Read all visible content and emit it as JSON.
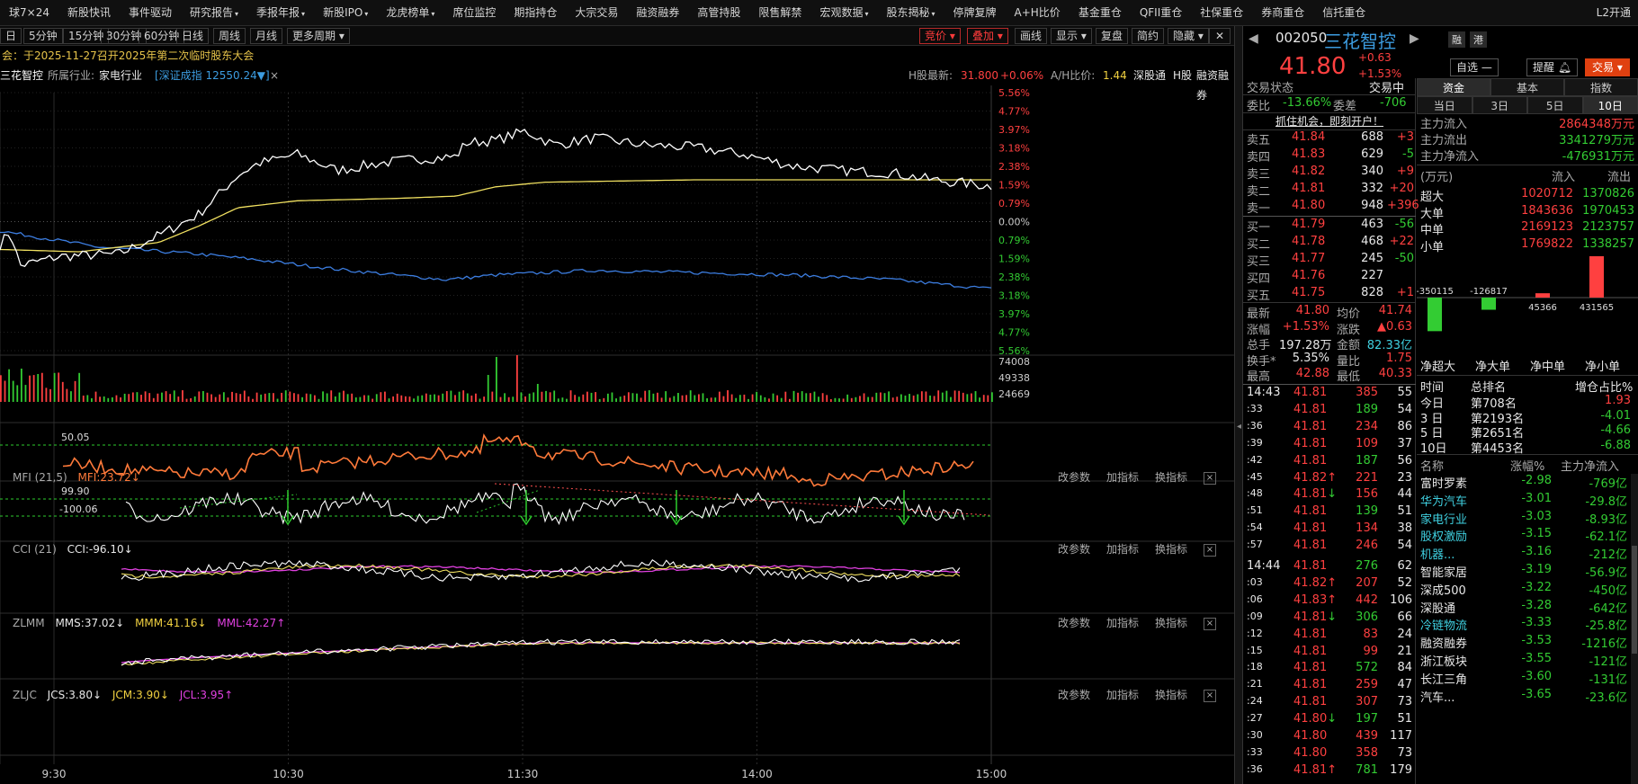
{
  "nav": [
    "球7×24",
    "新股快讯",
    "事件驱动",
    "研究报告",
    "季报年报",
    "新股IPO",
    "龙虎榜单",
    "席位监控",
    "期指持仓",
    "大宗交易",
    "融资融券",
    "高管持股",
    "限售解禁",
    "宏观数据",
    "股东揭秘",
    "停牌复牌",
    "A+H比价",
    "基金重仓",
    "QFII重仓",
    "社保重仓",
    "券商重仓",
    "信托重仓"
  ],
  "nav_right": "L2开通",
  "periods": [
    "日",
    "5分钟",
    "15分钟",
    "30分钟",
    "60分钟",
    "日线",
    "周线",
    "月线",
    "更多周期"
  ],
  "toolbar": {
    "auction": "竞价",
    "overlay": "叠加",
    "draw": "画线",
    "display": "显示",
    "replay": "复盘",
    "simple": "简约",
    "hide": "隐藏"
  },
  "notice": "会：于2025-11-27召开2025年第二次临时股东大会",
  "info": {
    "name": "三花智控",
    "industry_label": "所属行业:",
    "industry": "家电行业",
    "index": "[深证成指 12550.24▼]",
    "h_label": "H股最新:",
    "h_price": "31.800",
    "h_pct": "+0.06%",
    "ah_label": "A/H比价:",
    "ah": "1.44",
    "sz": "深股通",
    "h": "H股",
    "rz": "融资融券"
  },
  "price_axis": {
    "right_up": [
      "5.56%",
      "4.77%",
      "3.97%",
      "3.18%",
      "2.38%",
      "1.59%",
      "0.79%",
      "0.00%",
      "0.79%",
      "1.59%",
      "2.38%",
      "3.18%",
      "3.97%",
      "4.77%",
      "5.56%"
    ]
  },
  "vol_axis": [
    "74008",
    "49338",
    "24669"
  ],
  "time_axis": [
    "9:30",
    "10:30",
    "11:30",
    "14:00",
    "15:00"
  ],
  "ind": {
    "mfi": {
      "name": "MFI (21,5)",
      "val": "MFI:23.72↓",
      "l1": "50.05"
    },
    "cci": {
      "name": "CCI (21)",
      "val": "CCI:-96.10↓",
      "l1": "99.90",
      "l2": "-100.06"
    },
    "zlmm": {
      "name": "ZLMM",
      "a": "MMS:37.02↓",
      "b": "MMM:41.16↓",
      "c": "MML:42.27↑"
    },
    "zljc": {
      "name": "ZLJC",
      "a": "JCS:3.80↓",
      "b": "JCM:3.90↓",
      "c": "JCL:3.95↑"
    },
    "tools": {
      "p": "改参数",
      "a": "加指标",
      "c": "换指标",
      "x": "×"
    }
  },
  "quote": {
    "code": "002050",
    "name": "三花智控",
    "price": "41.80",
    "chg": "+0.63",
    "pct": "+1.53%",
    "rong": "融",
    "gang": "港",
    "zixuan": "自选",
    "remind": "提醒",
    "trade": "交易"
  },
  "status": {
    "label": "交易状态",
    "val": "交易中",
    "wb_l": "委比",
    "wb": "-13.66%",
    "wc_l": "委差",
    "wc": "-706",
    "ad": "抓住机会，即刻开户！"
  },
  "sells": [
    [
      "卖五",
      "41.84",
      "688",
      "+3"
    ],
    [
      "卖四",
      "41.83",
      "629",
      "-5"
    ],
    [
      "卖三",
      "41.82",
      "340",
      "+9"
    ],
    [
      "卖二",
      "41.81",
      "332",
      "+20"
    ],
    [
      "卖一",
      "41.80",
      "948",
      "+396"
    ]
  ],
  "buys": [
    [
      "买一",
      "41.79",
      "463",
      "-56"
    ],
    [
      "买二",
      "41.78",
      "468",
      "+22"
    ],
    [
      "买三",
      "41.77",
      "245",
      "-50"
    ],
    [
      "买四",
      "41.76",
      "227",
      ""
    ],
    [
      "买五",
      "41.75",
      "828",
      "+1"
    ]
  ],
  "stats": [
    [
      "最新",
      "41.80",
      "均价",
      "41.74"
    ],
    [
      "涨幅",
      "+1.53%",
      "涨跌",
      "▲0.63"
    ],
    [
      "总手",
      "197.28万",
      "金额",
      "82.33亿"
    ],
    [
      "换手*",
      "5.35%",
      "量比",
      "1.75"
    ],
    [
      "最高",
      "42.88",
      "最低",
      "40.33"
    ]
  ],
  "ticks": [
    [
      "14:43",
      "41.81",
      "385",
      "55"
    ],
    [
      ":33",
      "41.81",
      "189",
      "54"
    ],
    [
      ":36",
      "41.81",
      "234",
      "86"
    ],
    [
      ":39",
      "41.81",
      "109",
      "37"
    ],
    [
      ":42",
      "41.81",
      "187",
      "56"
    ],
    [
      ":45",
      "41.82↑",
      "221",
      "23"
    ],
    [
      ":48",
      "41.81↓",
      "156",
      "44"
    ],
    [
      ":51",
      "41.81",
      "139",
      "51"
    ],
    [
      ":54",
      "41.81",
      "134",
      "38"
    ],
    [
      ":57",
      "41.81",
      "246",
      "54"
    ],
    [
      "14:44",
      "41.81",
      "276",
      "62"
    ],
    [
      ":03",
      "41.82↑",
      "207",
      "52"
    ],
    [
      ":06",
      "41.83↑",
      "442",
      "106"
    ],
    [
      ":09",
      "41.81↓",
      "306",
      "66"
    ],
    [
      ":12",
      "41.81",
      "83",
      "24"
    ],
    [
      ":15",
      "41.81",
      "99",
      "21"
    ],
    [
      ":18",
      "41.81",
      "572",
      "84"
    ],
    [
      ":21",
      "41.81",
      "259",
      "47"
    ],
    [
      ":24",
      "41.81",
      "307",
      "73"
    ],
    [
      ":27",
      "41.80↓",
      "197",
      "51"
    ],
    [
      ":30",
      "41.80",
      "439",
      "117"
    ],
    [
      ":33",
      "41.80",
      "358",
      "73"
    ],
    [
      ":36",
      "41.81↑",
      "781",
      "179"
    ]
  ],
  "fund": {
    "tabs": [
      "资金",
      "基本",
      "指数"
    ],
    "days": [
      "当日",
      "3日",
      "5日",
      "10日"
    ],
    "in_l": "主力流入",
    "in": "2864348万元",
    "out_l": "主力流出",
    "out": "3341279万元",
    "net_l": "主力净流入",
    "net": "-476931万元",
    "hdr": [
      "(万元)",
      "流入",
      "流出"
    ],
    "rows": [
      [
        "超大",
        "1020712",
        "1370826"
      ],
      [
        "大单",
        "1843636",
        "1970453"
      ],
      [
        "中单",
        "2169123",
        "2123757"
      ],
      [
        "小单",
        "1769822",
        "1338257"
      ]
    ],
    "bars": [
      {
        "label": "-350115",
        "v": -350115
      },
      {
        "label": "-126817",
        "v": -126817
      },
      {
        "label": "45366",
        "v": 45366
      },
      {
        "label": "431565",
        "v": 431565
      }
    ],
    "barnames": [
      "净超大",
      "净大单",
      "净中单",
      "净小单"
    ],
    "rank_hdr": [
      "时间",
      "总排名",
      "增仓占比%"
    ],
    "ranks": [
      [
        "今日",
        "第708名",
        "1.93"
      ],
      [
        "3 日",
        "第2193名",
        "-4.01"
      ],
      [
        "5 日",
        "第2651名",
        "-4.66"
      ],
      [
        "10日",
        "第4453名",
        "-6.88"
      ]
    ],
    "sect_hdr": [
      "名称",
      "涨幅%",
      "主力净流入"
    ],
    "sectors": [
      [
        "富时罗素",
        "-2.98",
        "-769亿"
      ],
      [
        "华为汽车",
        "-3.01",
        "-29.8亿"
      ],
      [
        "家电行业",
        "-3.03",
        "-8.93亿"
      ],
      [
        "股权激励",
        "-3.15",
        "-62.1亿"
      ],
      [
        "机器...",
        "-3.16",
        "-212亿"
      ],
      [
        "智能家居",
        "-3.19",
        "-56.9亿"
      ],
      [
        "深成500",
        "-3.22",
        "-450亿"
      ],
      [
        "深股通",
        "-3.28",
        "-642亿"
      ],
      [
        "冷链物流",
        "-3.33",
        "-25.8亿"
      ],
      [
        "融资融券",
        "-3.53",
        "-1216亿"
      ],
      [
        "浙江板块",
        "-3.55",
        "-121亿"
      ],
      [
        "长江三角",
        "-3.60",
        "-131亿"
      ],
      [
        "汽车...",
        "-3.65",
        "-23.6亿"
      ]
    ]
  },
  "colors": {
    "up": "#ff4040",
    "down": "#33cc33",
    "avg": "#f0e060",
    "price": "#ffffff",
    "index": "#3c7de0",
    "mfi": "#ff7a3a"
  }
}
